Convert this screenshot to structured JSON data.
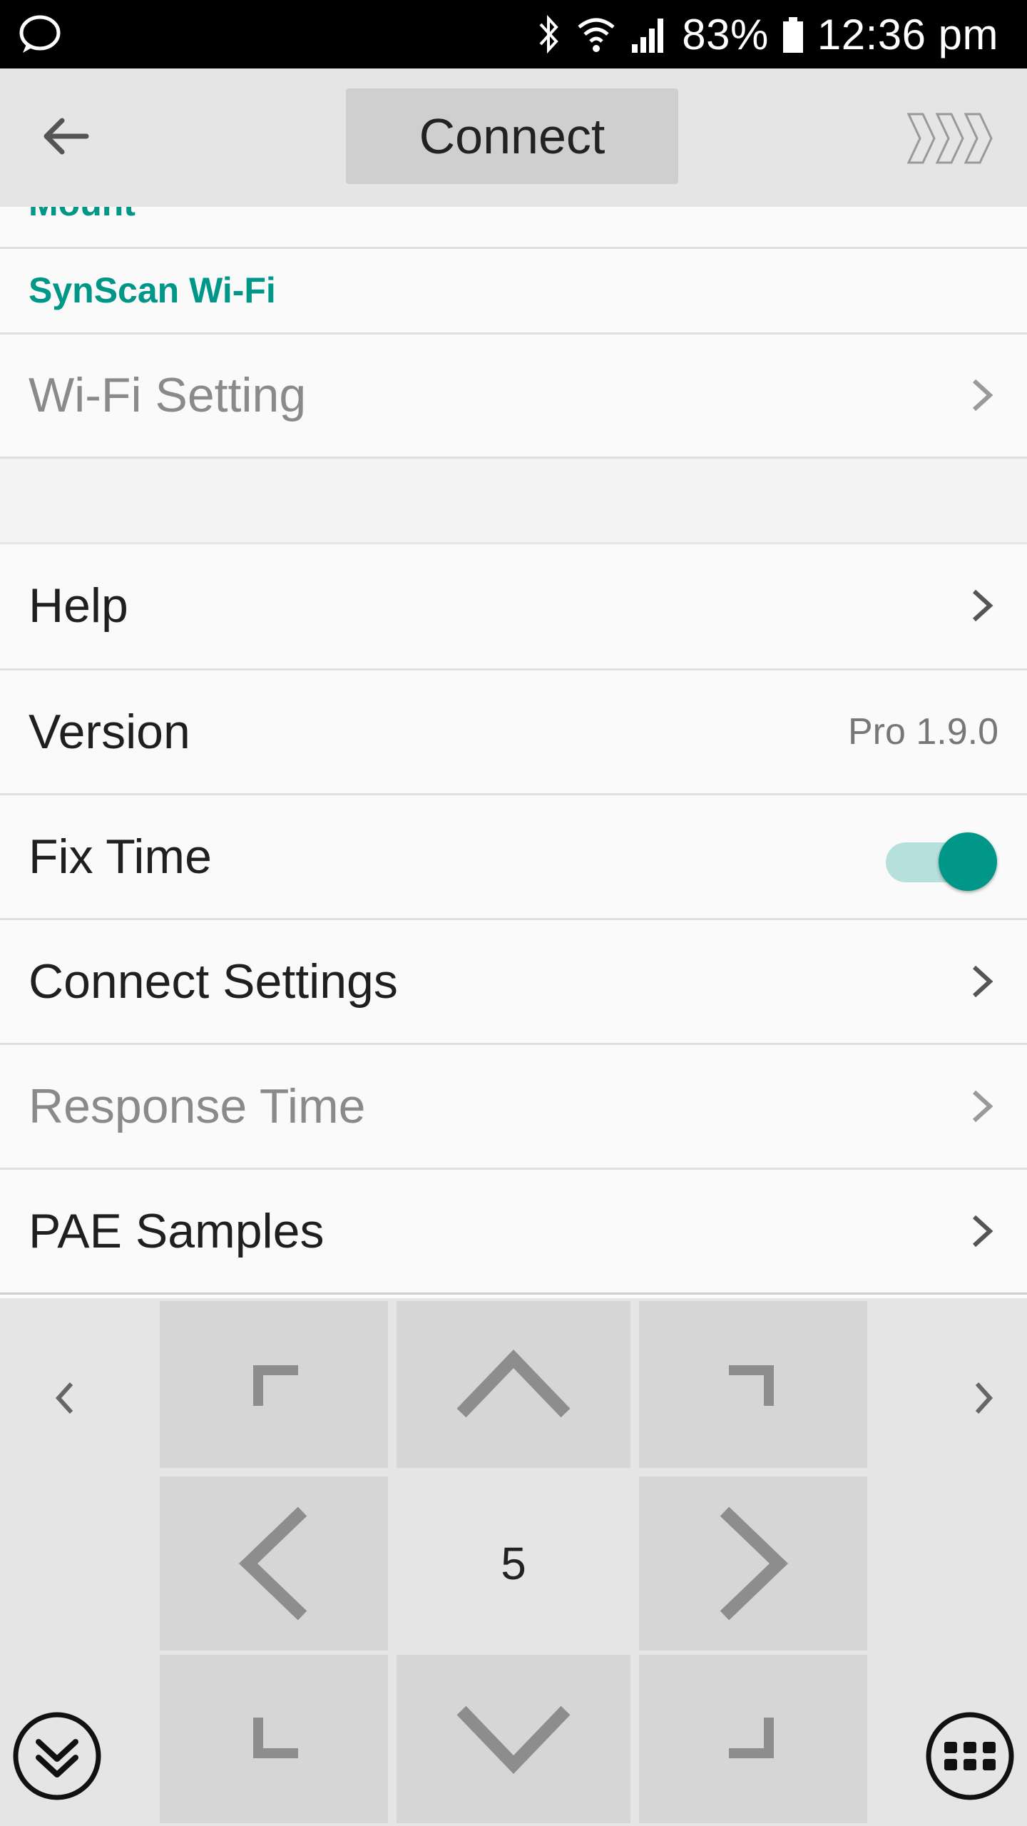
{
  "status_bar": {
    "battery": "83%",
    "time": "12:36 pm",
    "icons": [
      "chat-bubble-icon",
      "bluetooth-icon",
      "wifi-icon",
      "signal-icon",
      "battery-icon"
    ]
  },
  "app_bar": {
    "connect_label": "Connect"
  },
  "settings": {
    "partial_section": "Mount",
    "wifi_section": "SynScan Wi-Fi",
    "wifi_setting": "Wi-Fi Setting",
    "help": "Help",
    "version_label": "Version",
    "version_value": "Pro 1.9.0",
    "fix_time": "Fix Time",
    "fix_time_on": true,
    "connect_settings": "Connect Settings",
    "response_time": "Response Time",
    "pae_samples": "PAE Samples"
  },
  "control_pad": {
    "rate": "5"
  },
  "colors": {
    "accent": "#009688",
    "toggle_track": "#b6e0dc",
    "app_bar": "#e5e5e5",
    "pad_button": "#d6d6d6"
  }
}
